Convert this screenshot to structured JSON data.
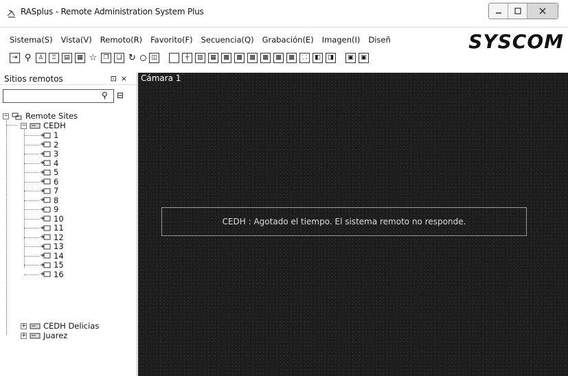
{
  "window": {
    "title": "RASplus - Remote Administration System Plus",
    "app_icon": "satellite-dish-icon",
    "buttons": [
      "minimize-icon",
      "maximize-icon",
      "close-icon"
    ]
  },
  "menu": {
    "items": [
      "Sistema(S)",
      "Vista(V)",
      "Remoto(R)",
      "Favorito(F)",
      "Secuencia(Q)",
      "Grabación(E)",
      "Imagen(I)",
      "Diseñ"
    ]
  },
  "logo": {
    "text": "SYSCOM"
  },
  "sidebar": {
    "title": "Sitios remotos",
    "pin_glyph": "⊡",
    "close_glyph": "×",
    "search": {
      "value": "",
      "placeholder": ""
    },
    "tree": {
      "root": "Remote Sites",
      "sites": [
        {
          "name": "CEDH",
          "expanded": true,
          "cameras": [
            "1",
            "2",
            "3",
            "4",
            "5",
            "6",
            "7",
            "8",
            "9",
            "10",
            "11",
            "12",
            "13",
            "14",
            "15",
            "16"
          ]
        },
        {
          "name": "CEDH Delicias",
          "expanded": false,
          "cameras": []
        },
        {
          "name": "Juarez",
          "expanded": false,
          "cameras": []
        }
      ]
    }
  },
  "camera_panel": {
    "label": "Cámara 1",
    "message": "CEDH : Agotado el tiempo. El sistema remoto no responde."
  }
}
